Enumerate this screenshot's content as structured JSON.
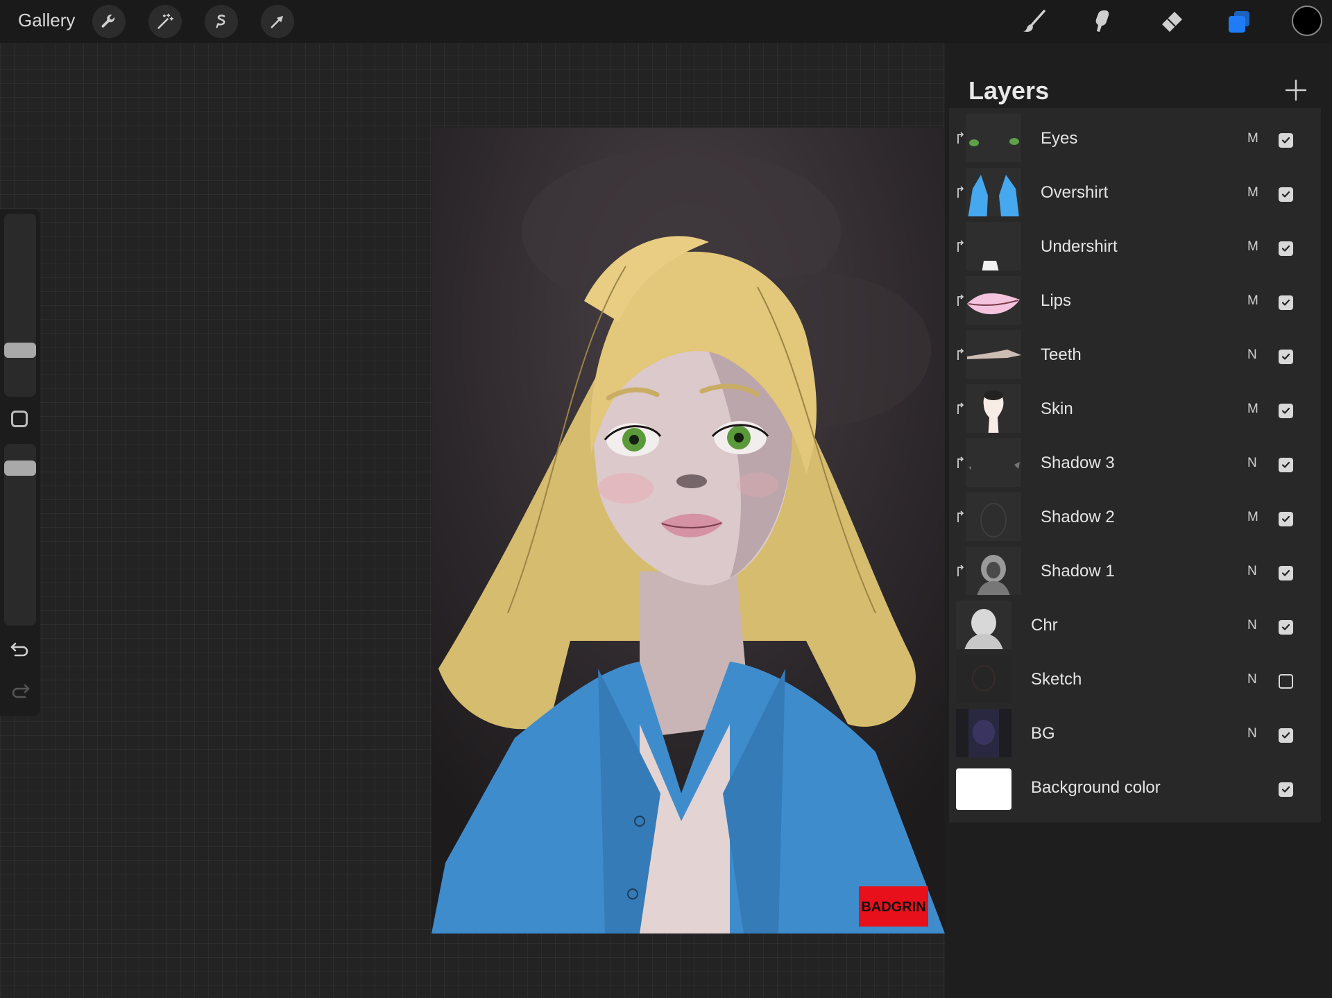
{
  "app": {
    "gallery_label": "Gallery",
    "toolbar_left_icons": [
      "wrench-icon",
      "magic-wand-icon",
      "selection-icon",
      "transform-arrow-icon"
    ],
    "toolbar_right_icons": [
      "brush-icon",
      "smudge-icon",
      "eraser-icon",
      "layers-icon"
    ],
    "current_color": "#000000",
    "accent_color": "#1f7cf6"
  },
  "sidebar": {
    "icons": [
      "modify-square-icon",
      "undo-icon",
      "redo-icon"
    ],
    "brush_size_level": 0.42,
    "opacity_level": 0.7
  },
  "canvas": {
    "watermark": "BADGRIN"
  },
  "layers_panel": {
    "title": "Layers",
    "add_icon": "plus-icon",
    "layers": [
      {
        "name": "Eyes",
        "blend": "M",
        "visible": true,
        "clipped": true
      },
      {
        "name": "Overshirt",
        "blend": "M",
        "visible": true,
        "clipped": true
      },
      {
        "name": "Undershirt",
        "blend": "M",
        "visible": true,
        "clipped": true
      },
      {
        "name": "Lips",
        "blend": "M",
        "visible": true,
        "clipped": true
      },
      {
        "name": "Teeth",
        "blend": "N",
        "visible": true,
        "clipped": true
      },
      {
        "name": "Skin",
        "blend": "M",
        "visible": true,
        "clipped": true
      },
      {
        "name": "Shadow 3",
        "blend": "N",
        "visible": true,
        "clipped": true
      },
      {
        "name": "Shadow 2",
        "blend": "M",
        "visible": true,
        "clipped": true
      },
      {
        "name": "Shadow 1",
        "blend": "N",
        "visible": true,
        "clipped": true
      },
      {
        "name": "Chr",
        "blend": "N",
        "visible": true,
        "clipped": false
      },
      {
        "name": "Sketch",
        "blend": "N",
        "visible": false,
        "clipped": false
      },
      {
        "name": "BG",
        "blend": "N",
        "visible": true,
        "clipped": false
      },
      {
        "name": "Background color",
        "blend": "",
        "visible": true,
        "clipped": false
      }
    ]
  }
}
